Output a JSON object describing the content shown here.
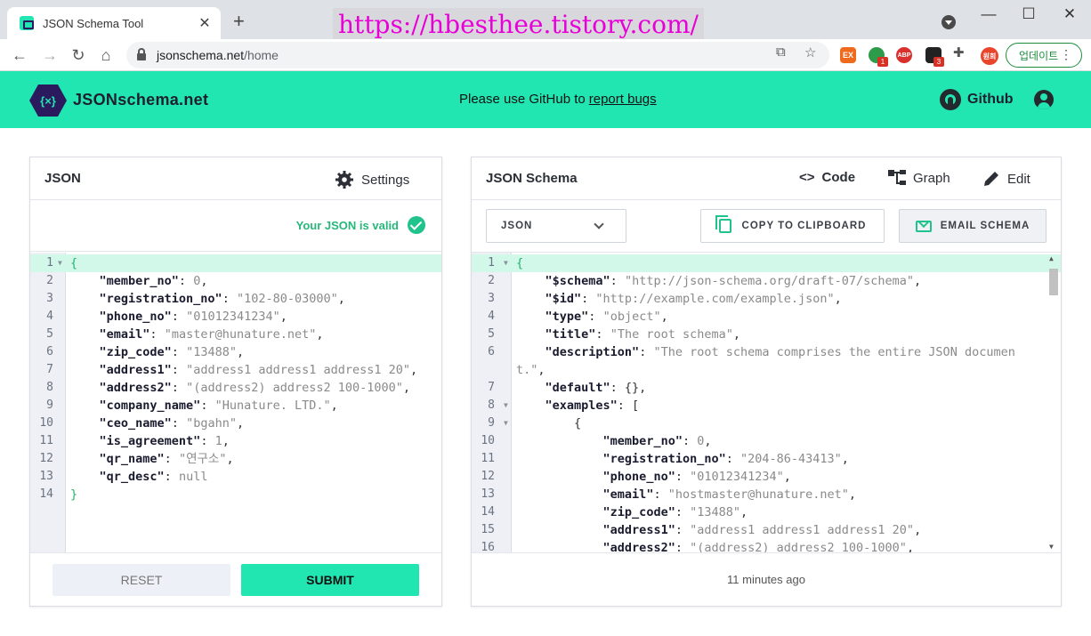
{
  "browser": {
    "tab_title": "JSON Schema Tool",
    "watermark": "https://hbesthee.tistory.com/",
    "url_host": "jsonschema.net",
    "url_path": "/home",
    "update_label": "업데이트",
    "ext_badges": [
      "1",
      "3"
    ],
    "ext_labels": [
      "EX",
      "ABP",
      "원희"
    ]
  },
  "header": {
    "brand": "JSONschema.net",
    "notice_prefix": "Please use GitHub to",
    "notice_link": "report bugs",
    "github_label": "Github"
  },
  "left_panel": {
    "title": "JSON",
    "settings_label": "Settings",
    "valid_text": "Your JSON is valid",
    "reset_label": "RESET",
    "submit_label": "SUBMIT",
    "lines": [
      {
        "n": "1",
        "fold": true,
        "code": [
          [
            "br",
            "{"
          ]
        ]
      },
      {
        "n": "2",
        "code": [
          [
            "i",
            "    "
          ],
          [
            "k",
            "\"member_no\""
          ],
          [
            "p",
            ": "
          ],
          [
            "n",
            "0"
          ],
          [
            "p",
            ","
          ]
        ]
      },
      {
        "n": "3",
        "code": [
          [
            "i",
            "    "
          ],
          [
            "k",
            "\"registration_no\""
          ],
          [
            "p",
            ": "
          ],
          [
            "s",
            "\"102-80-03000\""
          ],
          [
            "p",
            ","
          ]
        ]
      },
      {
        "n": "4",
        "code": [
          [
            "i",
            "    "
          ],
          [
            "k",
            "\"phone_no\""
          ],
          [
            "p",
            ": "
          ],
          [
            "s",
            "\"01012341234\""
          ],
          [
            "p",
            ","
          ]
        ]
      },
      {
        "n": "5",
        "code": [
          [
            "i",
            "    "
          ],
          [
            "k",
            "\"email\""
          ],
          [
            "p",
            ": "
          ],
          [
            "s",
            "\"master@hunature.net\""
          ],
          [
            "p",
            ","
          ]
        ]
      },
      {
        "n": "6",
        "code": [
          [
            "i",
            "    "
          ],
          [
            "k",
            "\"zip_code\""
          ],
          [
            "p",
            ": "
          ],
          [
            "s",
            "\"13488\""
          ],
          [
            "p",
            ","
          ]
        ]
      },
      {
        "n": "7",
        "code": [
          [
            "i",
            "    "
          ],
          [
            "k",
            "\"address1\""
          ],
          [
            "p",
            ": "
          ],
          [
            "s",
            "\"address1 address1 address1 20\""
          ],
          [
            "p",
            ","
          ]
        ]
      },
      {
        "n": "8",
        "code": [
          [
            "i",
            "    "
          ],
          [
            "k",
            "\"address2\""
          ],
          [
            "p",
            ": "
          ],
          [
            "s",
            "\"(address2) address2 100-1000\""
          ],
          [
            "p",
            ","
          ]
        ]
      },
      {
        "n": "9",
        "code": [
          [
            "i",
            "    "
          ],
          [
            "k",
            "\"company_name\""
          ],
          [
            "p",
            ": "
          ],
          [
            "s",
            "\"Hunature. LTD.\""
          ],
          [
            "p",
            ","
          ]
        ]
      },
      {
        "n": "10",
        "code": [
          [
            "i",
            "    "
          ],
          [
            "k",
            "\"ceo_name\""
          ],
          [
            "p",
            ": "
          ],
          [
            "s",
            "\"bgahn\""
          ],
          [
            "p",
            ","
          ]
        ]
      },
      {
        "n": "11",
        "code": [
          [
            "i",
            "    "
          ],
          [
            "k",
            "\"is_agreement\""
          ],
          [
            "p",
            ": "
          ],
          [
            "n",
            "1"
          ],
          [
            "p",
            ","
          ]
        ]
      },
      {
        "n": "12",
        "code": [
          [
            "i",
            "    "
          ],
          [
            "k",
            "\"qr_name\""
          ],
          [
            "p",
            ": "
          ],
          [
            "s",
            "\"연구소\""
          ],
          [
            "p",
            ","
          ]
        ]
      },
      {
        "n": "13",
        "code": [
          [
            "i",
            "    "
          ],
          [
            "k",
            "\"qr_desc\""
          ],
          [
            "p",
            ": "
          ],
          [
            "n",
            "null"
          ]
        ]
      },
      {
        "n": "14",
        "code": [
          [
            "br",
            "}"
          ]
        ]
      }
    ]
  },
  "right_panel": {
    "title": "JSON Schema",
    "tabs": [
      "Code",
      "Graph",
      "Edit"
    ],
    "format_value": "JSON",
    "copy_label": "COPY TO CLIPBOARD",
    "email_label": "EMAIL SCHEMA",
    "footer_time": "11 minutes ago",
    "lines": [
      {
        "n": "1",
        "fold": true,
        "code": [
          [
            "br",
            "{"
          ]
        ]
      },
      {
        "n": "2",
        "code": [
          [
            "i",
            "    "
          ],
          [
            "k",
            "\"$schema\""
          ],
          [
            "p",
            ": "
          ],
          [
            "s",
            "\"http://json-schema.org/draft-07/schema\""
          ],
          [
            "p",
            ","
          ]
        ]
      },
      {
        "n": "3",
        "code": [
          [
            "i",
            "    "
          ],
          [
            "k",
            "\"$id\""
          ],
          [
            "p",
            ": "
          ],
          [
            "s",
            "\"http://example.com/example.json\""
          ],
          [
            "p",
            ","
          ]
        ]
      },
      {
        "n": "4",
        "code": [
          [
            "i",
            "    "
          ],
          [
            "k",
            "\"type\""
          ],
          [
            "p",
            ": "
          ],
          [
            "s",
            "\"object\""
          ],
          [
            "p",
            ","
          ]
        ]
      },
      {
        "n": "5",
        "code": [
          [
            "i",
            "    "
          ],
          [
            "k",
            "\"title\""
          ],
          [
            "p",
            ": "
          ],
          [
            "s",
            "\"The root schema\""
          ],
          [
            "p",
            ","
          ]
        ]
      },
      {
        "n": "6",
        "code": [
          [
            "i",
            "    "
          ],
          [
            "k",
            "\"description\""
          ],
          [
            "p",
            ": "
          ],
          [
            "s",
            "\"The root schema comprises the entire JSON documen"
          ]
        ]
      },
      {
        "n": "",
        "code": [
          [
            "s",
            "t.\""
          ],
          [
            "p",
            ","
          ]
        ]
      },
      {
        "n": "7",
        "code": [
          [
            "i",
            "    "
          ],
          [
            "k",
            "\"default\""
          ],
          [
            "p",
            ": {},"
          ]
        ]
      },
      {
        "n": "8",
        "fold": true,
        "code": [
          [
            "i",
            "    "
          ],
          [
            "k",
            "\"examples\""
          ],
          [
            "p",
            ": ["
          ]
        ]
      },
      {
        "n": "9",
        "fold": true,
        "code": [
          [
            "i",
            "        "
          ],
          [
            "p",
            "{"
          ]
        ]
      },
      {
        "n": "10",
        "code": [
          [
            "i",
            "            "
          ],
          [
            "k",
            "\"member_no\""
          ],
          [
            "p",
            ": "
          ],
          [
            "n",
            "0"
          ],
          [
            "p",
            ","
          ]
        ]
      },
      {
        "n": "11",
        "code": [
          [
            "i",
            "            "
          ],
          [
            "k",
            "\"registration_no\""
          ],
          [
            "p",
            ": "
          ],
          [
            "s",
            "\"204-86-43413\""
          ],
          [
            "p",
            ","
          ]
        ]
      },
      {
        "n": "12",
        "code": [
          [
            "i",
            "            "
          ],
          [
            "k",
            "\"phone_no\""
          ],
          [
            "p",
            ": "
          ],
          [
            "s",
            "\"01012341234\""
          ],
          [
            "p",
            ","
          ]
        ]
      },
      {
        "n": "13",
        "code": [
          [
            "i",
            "            "
          ],
          [
            "k",
            "\"email\""
          ],
          [
            "p",
            ": "
          ],
          [
            "s",
            "\"hostmaster@hunature.net\""
          ],
          [
            "p",
            ","
          ]
        ]
      },
      {
        "n": "14",
        "code": [
          [
            "i",
            "            "
          ],
          [
            "k",
            "\"zip_code\""
          ],
          [
            "p",
            ": "
          ],
          [
            "s",
            "\"13488\""
          ],
          [
            "p",
            ","
          ]
        ]
      },
      {
        "n": "15",
        "code": [
          [
            "i",
            "            "
          ],
          [
            "k",
            "\"address1\""
          ],
          [
            "p",
            ": "
          ],
          [
            "s",
            "\"address1 address1 address1 20\""
          ],
          [
            "p",
            ","
          ]
        ]
      },
      {
        "n": "16",
        "code": [
          [
            "i",
            "            "
          ],
          [
            "k",
            "\"address2\""
          ],
          [
            "p",
            ": "
          ],
          [
            "s",
            "\"(address2) address2 100-1000\""
          ],
          [
            "p",
            ","
          ]
        ]
      }
    ]
  },
  "colors": {
    "brand_green": "#21e6b2",
    "valid_green": "#27b77a",
    "line_highlight": "#d2f8ea"
  }
}
